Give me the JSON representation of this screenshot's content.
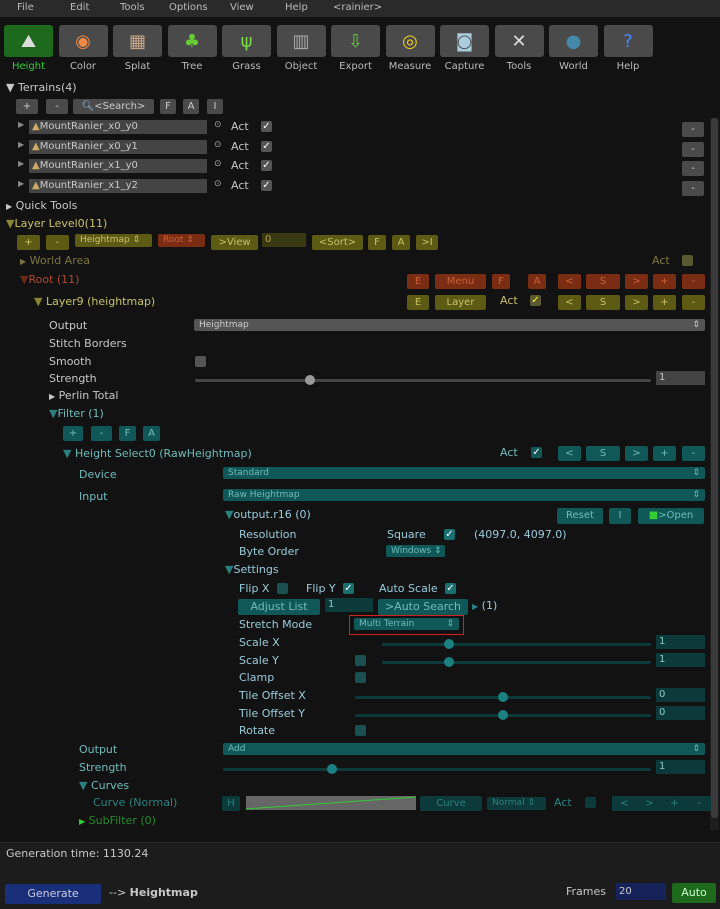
{
  "menu": [
    "File",
    "Edit",
    "Tools",
    "Options",
    "View",
    "Help",
    "<rainier>"
  ],
  "toolbar": [
    {
      "label": "Height",
      "icon": "mountain-icon",
      "active": true
    },
    {
      "label": "Color",
      "icon": "color-wheel-icon"
    },
    {
      "label": "Splat",
      "icon": "splat-icon"
    },
    {
      "label": "Tree",
      "icon": "tree-icon"
    },
    {
      "label": "Grass",
      "icon": "grass-icon"
    },
    {
      "label": "Object",
      "icon": "building-icon"
    },
    {
      "label": "Export",
      "icon": "export-icon"
    },
    {
      "label": "Measure",
      "icon": "tape-measure-icon"
    },
    {
      "label": "Capture",
      "icon": "camera-icon"
    },
    {
      "label": "Tools",
      "icon": "tools-icon"
    },
    {
      "label": "World",
      "icon": "globe-icon"
    },
    {
      "label": "Help",
      "icon": "help-icon"
    }
  ],
  "terrains": {
    "title": "Terrains(4)",
    "buttons": [
      "+",
      "-",
      "<Search>",
      "F",
      "A",
      "I"
    ],
    "items": [
      "MountRanier_x0_y0",
      "MountRanier_x0_y1",
      "MountRanier_x1_y0",
      "MountRanier_x1_y2"
    ],
    "act": "Act",
    "remove": "-"
  },
  "quick_tools": "Quick Tools",
  "layer_level": {
    "title": "Layer Level0(11)",
    "plus": "+",
    "minus": "-",
    "type": "Heightmap",
    "root": "Root",
    "view": ">View",
    "value": "0",
    "sort": "<Sort>",
    "f": "F",
    "a": "A",
    "i": ">I"
  },
  "world_area": {
    "label": "World Area",
    "act": "Act"
  },
  "root": {
    "label": "Root (11)",
    "buttons": [
      "E",
      "Menu",
      "F",
      "A",
      "<",
      "S",
      ">",
      "+",
      "-"
    ]
  },
  "layer9": {
    "label": "Layer9 (heightmap)",
    "e": "E",
    "layer": "Layer",
    "act": "Act",
    "nav": [
      "<",
      "S",
      ">",
      "+",
      "-"
    ]
  },
  "layer_props": {
    "output_label": "Output",
    "output": "Heightmap",
    "stitch": "Stitch Borders",
    "smooth": "Smooth",
    "strength_label": "Strength",
    "strength": "1",
    "strength_level": 0.25,
    "perlin": "Perlin Total",
    "filter": "Filter (1)",
    "filter_buttons": [
      "+",
      "-",
      "F",
      "A"
    ]
  },
  "height_select": {
    "label": "Height Select0 (RawHeightmap)",
    "act": "Act",
    "nav": [
      "<",
      "S",
      ">",
      "+",
      "-"
    ],
    "device_label": "Device",
    "device": "Standard",
    "input_label": "Input",
    "input": "Raw Heightmap",
    "file": "output.r16 (0)",
    "reset": "Reset",
    "i": "I",
    "open": ">Open",
    "resolution_label": "Resolution",
    "square": "Square",
    "resolution": "(4097.0, 4097.0)",
    "byte_order_label": "Byte Order",
    "byte_order": "Windows",
    "settings": "Settings",
    "flip_x": "Flip X",
    "flip_y": "Flip Y",
    "auto_scale": "Auto Scale",
    "adjust_list": "Adjust List",
    "adjust_value": "1",
    "auto_search": ">Auto Search",
    "auto_search_count": "(1)",
    "stretch_label": "Stretch Mode",
    "stretch": "Multi Terrain",
    "scale_x_label": "Scale X",
    "scale_x": "1",
    "scale_y_label": "Scale Y",
    "scale_y": "1",
    "clamp": "Clamp",
    "tile_x_label": "Tile Offset X",
    "tile_x": "0",
    "tile_y_label": "Tile Offset Y",
    "tile_y": "0",
    "rotate": "Rotate",
    "output_label": "Output",
    "output": "Add",
    "strength_label": "Strength",
    "strength": "1",
    "curves": "Curves",
    "curve_label": "Curve (Normal)",
    "curve_h": "H",
    "curve_btn": "Curve",
    "curve_mode": "Normal",
    "curve_act": "Act",
    "curve_nav": [
      "<",
      ">",
      "+",
      "-"
    ],
    "subfilter": "SubFilter (0)"
  },
  "status": {
    "generation_time": "Generation time: 1130.24",
    "generate": "Generate",
    "arrow": "-->",
    "target": "Heightmap",
    "frames_label": "Frames",
    "frames": "20",
    "auto": "Auto"
  },
  "colors": {
    "olive": "#5d5a14",
    "red": "#7a2d12",
    "teal": "#105858",
    "active_green": "#1d6a1d",
    "generate_blue": "#1a2f7a"
  }
}
